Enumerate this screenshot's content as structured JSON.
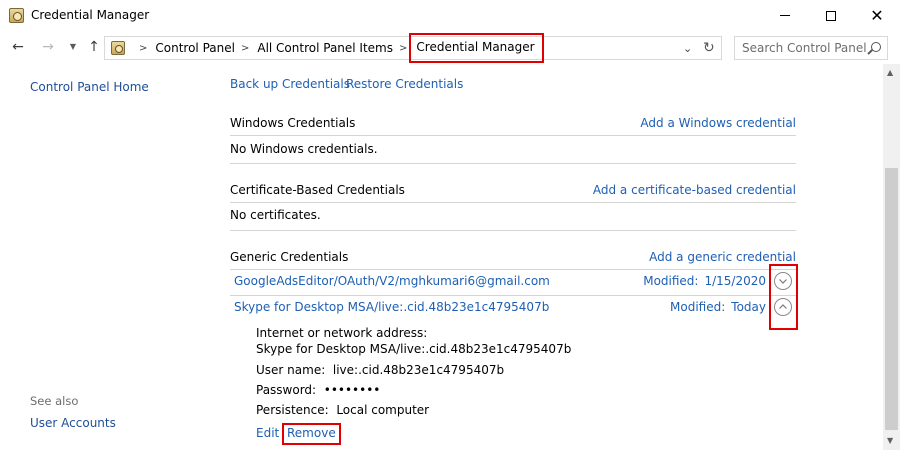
{
  "window": {
    "title": "Credential Manager"
  },
  "breadcrumb": {
    "items": [
      "Control Panel",
      "All Control Panel Items"
    ],
    "current": "Credential Manager"
  },
  "search": {
    "placeholder": "Search Control Panel"
  },
  "sidebar": {
    "home": "Control Panel Home",
    "see_also": "See also",
    "user_accounts": "User Accounts"
  },
  "actions": {
    "backup": "Back up Credentials",
    "restore": "Restore Credentials"
  },
  "sections": {
    "windows": {
      "title": "Windows Credentials",
      "add": "Add a Windows credential",
      "empty": "No Windows credentials."
    },
    "certificate": {
      "title": "Certificate-Based Credentials",
      "add": "Add a certificate-based credential",
      "empty": "No certificates."
    },
    "generic": {
      "title": "Generic Credentials",
      "add": "Add a generic credential",
      "items": [
        {
          "name": "GoogleAdsEditor/OAuth/V2/mghkumari6@gmail.com",
          "modified_label": "Modified:",
          "modified_value": "1/15/2020",
          "expanded": false
        },
        {
          "name": "Skype for Desktop MSA/live:.cid.48b23e1c4795407b",
          "modified_label": "Modified:",
          "modified_value": "Today",
          "expanded": true
        }
      ]
    }
  },
  "details": {
    "address_label": "Internet or network address:",
    "address_value": "Skype for Desktop MSA/live:.cid.48b23e1c4795407b",
    "username_label": "User name:",
    "username_value": "live:.cid.48b23e1c4795407b",
    "password_label": "Password:",
    "password_value": "••••••••",
    "persistence_label": "Persistence:",
    "persistence_value": "Local computer",
    "edit": "Edit",
    "remove": "Remove"
  },
  "colors": {
    "link": "#1e5fb4",
    "highlight": "#e00000"
  }
}
